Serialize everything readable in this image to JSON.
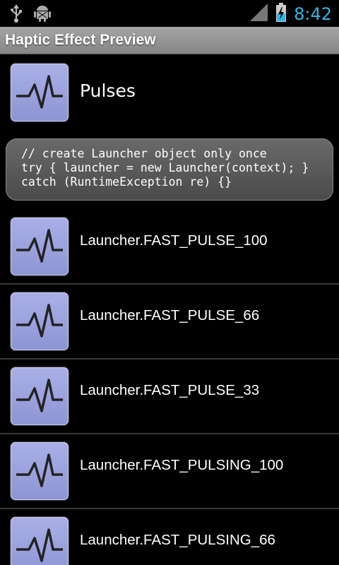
{
  "status_bar": {
    "left_icons": [
      "usb-icon",
      "android-debug-icon"
    ],
    "right_icons": [
      "signal-icon",
      "battery-charging-icon"
    ],
    "time": "8:42",
    "time_color": "#33b5e5"
  },
  "title_bar": {
    "title": "Haptic Effect Preview"
  },
  "header": {
    "icon": "waveform-icon",
    "label": "Pulses"
  },
  "code": {
    "lines": [
      "// create Launcher object only once",
      "try { launcher = new Launcher(context); }",
      "catch (RuntimeException re) {}"
    ]
  },
  "items": [
    {
      "label": "Launcher.FAST_PULSE_100",
      "icon": "waveform-icon"
    },
    {
      "label": "Launcher.FAST_PULSE_66",
      "icon": "waveform-icon"
    },
    {
      "label": "Launcher.FAST_PULSE_33",
      "icon": "waveform-icon"
    },
    {
      "label": "Launcher.FAST_PULSING_100",
      "icon": "waveform-icon"
    },
    {
      "label": "Launcher.FAST_PULSING_66",
      "icon": "waveform-icon"
    }
  ]
}
